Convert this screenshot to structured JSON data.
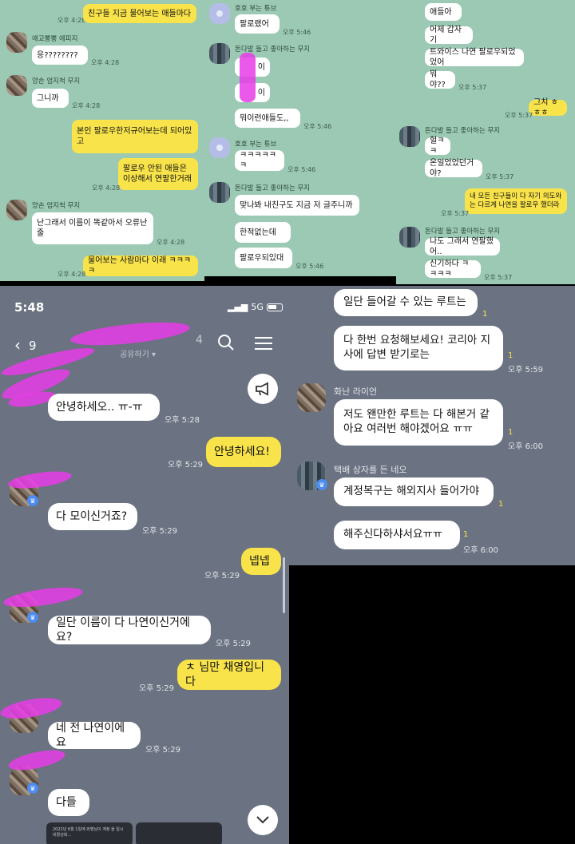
{
  "panel1": {
    "messages": [
      {
        "type": "out",
        "text": "친구들 지금 물어보는 애들마다",
        "time": "오후 4:28"
      },
      {
        "type": "in",
        "name": "애교뽕뽕 에피지",
        "text": "응????????",
        "time": "오후 4:28"
      },
      {
        "type": "in",
        "name": "양손 엄지척 무지",
        "text": "그니까",
        "time": "오후 4:28"
      },
      {
        "type": "out",
        "text": "본인 팔로우한저규어보는데 되어있고",
        "time": ""
      },
      {
        "type": "out",
        "text": "팔로우 안된 애들은 이상해서 연팔한거래",
        "time": "오후 4:28"
      },
      {
        "type": "in",
        "name": "양손 엄지척 무지",
        "text": "난그래서 이름이 똑같아서 오류난줄",
        "time": "오후 4:28"
      },
      {
        "type": "out",
        "text": "물어보는 사람마다 이래 ㅋㅋㅋㅋ",
        "time": "오후 4:28"
      }
    ]
  },
  "panel2": {
    "messages": [
      {
        "name": "호호 부는 튜브",
        "text": "팔로랬어",
        "time": "오후 5:46"
      },
      {
        "name": "돈다발 들고 좋아하는 무지",
        "text": "이",
        "time": ""
      },
      {
        "name": "",
        "text": "이",
        "time": ""
      },
      {
        "name": "",
        "text": "뭐이런애들도,,",
        "time": "오후 5:46"
      },
      {
        "name": "호호 부는 튜브",
        "text": "ㅋㅋㅋㅋㅋㅋ",
        "time": "오후 5:46"
      },
      {
        "name": "돈다발 들고 좋아하는 무지",
        "text": "맞나봐 내친구도 지금 저 글주니까",
        "time": ""
      },
      {
        "name": "",
        "text": "한적없는데",
        "time": ""
      },
      {
        "name": "",
        "text": "팔로우되있대",
        "time": "오후 5:46"
      }
    ]
  },
  "panel3": {
    "messages": [
      {
        "type": "in",
        "text": "애들아",
        "time": ""
      },
      {
        "type": "in",
        "text": "어제 갑자기",
        "time": ""
      },
      {
        "type": "in",
        "text": "트와이스 나연 팔로우되었었어",
        "time": ""
      },
      {
        "type": "in",
        "text": "뭐야??",
        "time": "오후 5:37"
      },
      {
        "type": "out",
        "text": "그치 ㅎㅎㅎ",
        "time": "오후 5:37"
      },
      {
        "type": "in",
        "name": "돈다발 들고 좋아하는 무지",
        "text": "헐ㅋㅋ",
        "time": ""
      },
      {
        "type": "in",
        "text": "온일었었던거야?",
        "time": "오후 5:37"
      },
      {
        "type": "out",
        "text": "내 모든 친구들이 다 자기 의도와는 다르게 나연을 팔로우 했더라",
        "time": "오후 5:37"
      },
      {
        "type": "in",
        "name": "돈다발 들고 좋아하는 무지",
        "text": "나도 그래서 연팔했어..",
        "time": ""
      },
      {
        "type": "in",
        "text": "신기하다 ㅋㅋㅋㅋ",
        "time": "오후 5:37"
      }
    ]
  },
  "main": {
    "status_time": "5:48",
    "status_location": "⌁",
    "network": "5G",
    "back_count": "9",
    "title_visible": "..",
    "member_count": "4",
    "subtitle": "공유하기 ▾",
    "messages": [
      {
        "type": "in",
        "text": "안녕하세오.. ㅠ-ㅠ",
        "time": "오후 5:28"
      },
      {
        "type": "out",
        "text": "안녕하세요!",
        "time": "오후 5:29"
      },
      {
        "type": "in",
        "text": "다 모이신거죠?",
        "time": "오후 5:29"
      },
      {
        "type": "out",
        "text": "넵넵",
        "time": "오후 5:29"
      },
      {
        "type": "in",
        "text": "일단 이름이 다 나연이신거에요?",
        "time": "오후 5:29"
      },
      {
        "type": "out",
        "text": "ㅊ 님만 채영입니다",
        "time": "오후 5:29"
      },
      {
        "type": "in",
        "text": "네 전 나연이에요",
        "time": "오후 5:29"
      },
      {
        "type": "in",
        "text": "다들",
        "time": ""
      }
    ],
    "thumb_text": "2022년 6월 1일에 와펜님이 계정 을 일시 비활성화…"
  },
  "right": {
    "messages": [
      {
        "name": "",
        "text": "일단 들어갈 수 있는 루트는",
        "read": "1",
        "time": ""
      },
      {
        "name": "",
        "text": "다 한번 요청해보세요! 코리아 지사에 답변 받기로는",
        "read": "1",
        "time": "오후 5:59"
      },
      {
        "name": "화난 라이언",
        "text": "저도 왠만한 루트는 다 해본거 같아요 여러번 해야겠어요 ㅠㅠ",
        "read": "1",
        "time": "오후 6:00"
      },
      {
        "name": "택배 상자를 든 네오",
        "text": "계정복구는 해외지사 들어가야",
        "read": "1",
        "time": ""
      },
      {
        "name": "",
        "text": "해주신다하샤서요ㅠㅠ",
        "read": "1",
        "time": "오후 6:00"
      }
    ]
  },
  "icons": [
    "back-chevron-icon",
    "search-icon",
    "menu-icon",
    "megaphone-icon",
    "chevron-down-icon",
    "crown-icon"
  ]
}
